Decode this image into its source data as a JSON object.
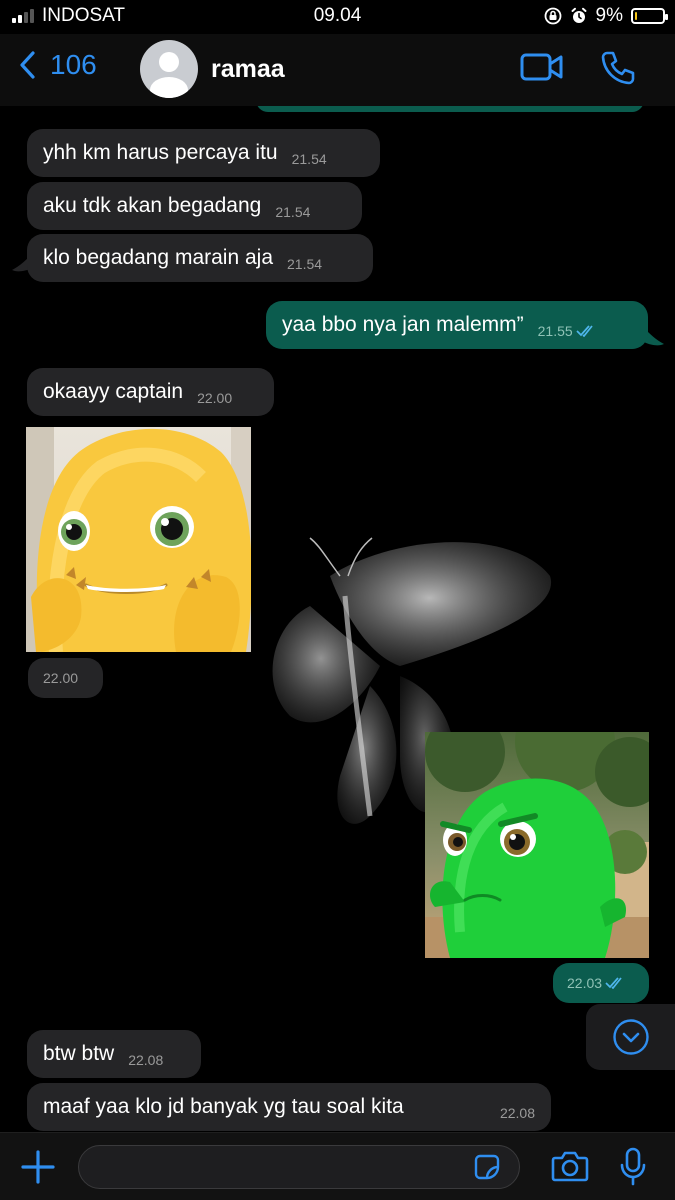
{
  "status": {
    "carrier": "INDOSAT",
    "time": "09.04",
    "battery": "9%",
    "battery_level": 0.09
  },
  "header": {
    "back_count": "106",
    "contact_name": "ramaa"
  },
  "messages": [
    {
      "text": "yhh km harus percaya itu",
      "time": "21.54"
    },
    {
      "text": "aku tdk akan begadang",
      "time": "21.54"
    },
    {
      "text": "klo begadang marain aja",
      "time": "21.54"
    },
    {
      "text": "yaa bbo nya jan malemm”",
      "time": "21.55"
    },
    {
      "text": "okaayy captain",
      "time": "22.00"
    },
    {
      "text": "",
      "time": "22.00"
    },
    {
      "text": "",
      "time": "22.03"
    },
    {
      "text": "btw btw",
      "time": "22.08"
    },
    {
      "text": "maaf yaa klo jd banyak yg tau soal kita",
      "time": "22.08"
    }
  ],
  "composer": {
    "value": "",
    "placeholder": ""
  },
  "colors": {
    "accent": "#2f8ef0",
    "outgoing": "#0b5c4e",
    "incoming": "#252527",
    "read_tick": "#4fb6ec"
  }
}
